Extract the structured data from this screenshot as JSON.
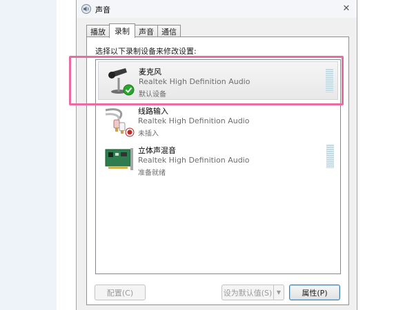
{
  "window": {
    "title": "声音",
    "close_glyph": "✕"
  },
  "tabs": [
    {
      "label": "播放",
      "active": false
    },
    {
      "label": "录制",
      "active": true
    },
    {
      "label": "声音",
      "active": false
    },
    {
      "label": "通信",
      "active": false
    }
  ],
  "panel": {
    "instruction": "选择以下录制设备来修改设置:"
  },
  "devices": [
    {
      "name": "麦克风",
      "description": "Realtek High Definition Audio",
      "status": "默认设备",
      "icon": "microphone-icon",
      "badge": "default-check-icon",
      "selected": true,
      "level_meter": true
    },
    {
      "name": "线路输入",
      "description": "Realtek High Definition Audio",
      "status": "未插入",
      "icon": "line-in-cable-icon",
      "badge": "unplugged-icon",
      "selected": false,
      "level_meter": false
    },
    {
      "name": "立体声混音",
      "description": "Realtek High Definition Audio",
      "status": "准备就绪",
      "icon": "sound-card-icon",
      "badge": null,
      "selected": false,
      "level_meter": true
    }
  ],
  "buttons": {
    "configure": "配置(C)",
    "set_default": "设为默认值(S)",
    "dropdown_glyph": "▼",
    "properties": "属性(P)"
  },
  "colors": {
    "highlight": "#ec6aa2",
    "selection": "#e8e8e8",
    "meter": "#c0dbe3"
  }
}
